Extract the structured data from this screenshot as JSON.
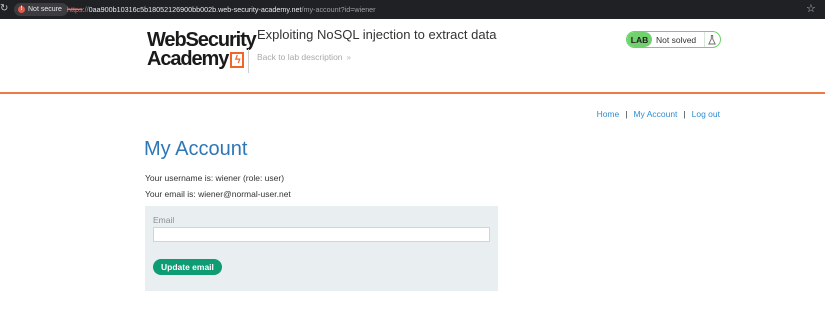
{
  "browser": {
    "security_label": "Not secure",
    "url_scheme": "https",
    "url_sep": "://",
    "url_host": "0aa900b10316c5b18052126900bb002b.web-security-academy.net",
    "url_path": "/my-account?id=wiener",
    "reload_icon": "reload-icon",
    "star_icon": "bookmark-star-icon"
  },
  "header": {
    "logo_line1": "WebSecurity",
    "logo_line2": "Academy",
    "lab_title": "Exploiting NoSQL injection to extract data",
    "back_link": "Back to lab description",
    "back_chevrons": "»",
    "lab_badge": "LAB",
    "lab_status": "Not solved",
    "accent_color": "#ef7a45",
    "status_color": "#70d16d"
  },
  "nav": {
    "home": "Home",
    "separator": "|",
    "my_account": "My Account",
    "log_out": "Log out"
  },
  "main": {
    "heading": "My Account",
    "username_line": "Your username is: wiener (role: user)",
    "email_line": "Your email is: wiener@normal-user.net",
    "form": {
      "email_label": "Email",
      "email_value": "",
      "submit_label": "Update email"
    }
  }
}
